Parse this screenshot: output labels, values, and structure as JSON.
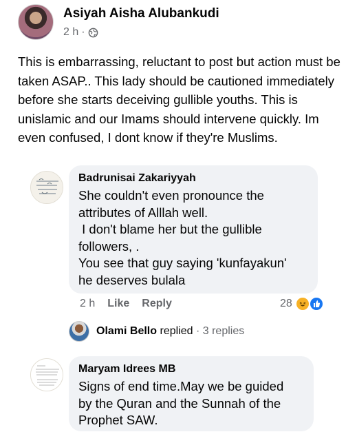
{
  "post": {
    "author": "Asiyah Aisha Alubankudi",
    "time": "2 h",
    "separator": "·",
    "body": "This is embarrassing, reluctant to post but action must be taken ASAP.. This lady should be cautioned immediately before she starts deceiving gullible youths. This is unislamic and our Imams should intervene quickly. Im even confused, I dont know if they're Muslims."
  },
  "comments": [
    {
      "author": "Badrunisai Zakariyyah",
      "lines": [
        "She couldn't even pronounce the",
        "attributes of Alllah well.",
        " I don't blame her but the gullible",
        "followers, .",
        "You see that guy saying 'kunfayakun'",
        "he deserves bulala"
      ],
      "time": "2 h",
      "like_label": "Like",
      "reply_label": "Reply",
      "reaction_count": "28",
      "reactions": [
        "haha-icon",
        "like-icon"
      ],
      "replies": {
        "name": "Olami Bello",
        "action": "replied",
        "separator": "·",
        "count": "3 replies"
      }
    },
    {
      "author": "Maryam Idrees MB",
      "lines": [
        "Signs of end time.May we be guided",
        "by the Quran and the Sunnah of the",
        "Prophet SAW."
      ]
    }
  ]
}
